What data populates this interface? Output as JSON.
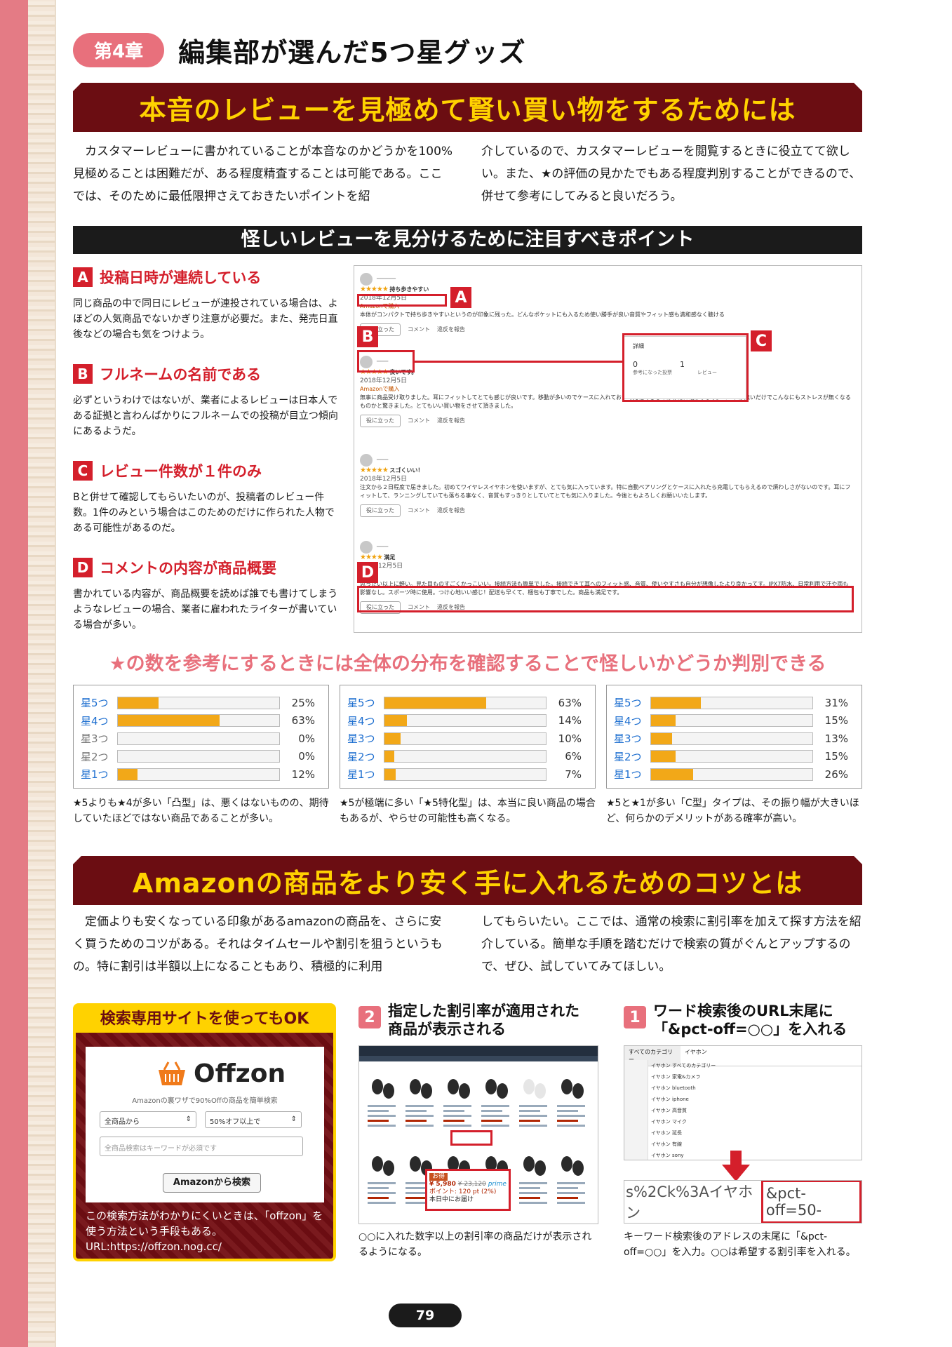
{
  "chapter": {
    "badge": "第4章",
    "title": "編集部が選んだ5つ星グッズ"
  },
  "section1": {
    "banner": "本音のレビューを見極めて賢い買い物をするためには",
    "col1": "カスタマーレビューに書かれていることが本音なのかどうかを100%見極めることは困難だが、ある程度精査することは可能である。ここでは、そのために最低限押さえておきたいポイントを紹",
    "col2": "介しているので、カスタマーレビューを閲覧するときに役立てて欲しい。また、★の評価の見かたでもある程度判別することができるので、併せて参考にしてみると良いだろう。"
  },
  "points_title": "怪しいレビューを見分けるために注目すべきポイント",
  "points": [
    {
      "letter": "A",
      "title": "投稿日時が連続している",
      "desc": "同じ商品の中で同日にレビューが連投されている場合は、よほどの人気商品でないかぎり注意が必要だ。また、発売日直後などの場合も気をつけよう。"
    },
    {
      "letter": "B",
      "title": "フルネームの名前である",
      "desc": "必ずというわけではないが、業者によるレビューは日本人である証拠と言わんばかりにフルネームでの投稿が目立つ傾向にあるようだ。"
    },
    {
      "letter": "C",
      "title": "レビュー件数が１件のみ",
      "desc": "Bと併せて確認してもらいたいのが、投稿者のレビュー件数。1件のみという場合はこのためのだけに作られた人物である可能性があるのだ。"
    },
    {
      "letter": "D",
      "title": "コメントの内容が商品概要",
      "desc": "書かれている内容が、商品概要を読めば誰でも書けてしまうようなレビューの場合、業者に雇われたライターが書いている場合が多い。"
    }
  ],
  "review_shot": {
    "reviews": [
      {
        "headline": "持ち歩きやすい",
        "date": "2018年12月5日",
        "vp": "Amazonで購入",
        "body": "本体がコンパクトで持ち歩きやすいというのが印象に残った。どんなポケットにも入るため使い勝手が良い音質やフィット感も満和感なく聴ける"
      },
      {
        "headline": "良いです。",
        "date": "2018年12月5日",
        "vp": "Amazonで購入",
        "body": "無事に商品受け取りました。耳にフィットしてとても感じが良いです。移動が多いのでケースに入れておいて充電できるのは非常に助かります。コードが無いだけでこんなにもストレスが無くなるものかと驚きました。とてもいい買い物をさせて頂きました。"
      },
      {
        "headline": "スゴくいい！",
        "date": "2018年12月5日",
        "vp": "",
        "body": "注文から２日程度で届きました。初めてワイヤレスイヤホンを使いますが、とても気に入っています。特に自動ペアリングとケースに入れたら充電してもらえるので煩わしさがないのです。耳にフィットして、ランニングしていても落ちる事なく、音質もすっきりとしていてとても気に入りました。今後ともよろしくお願いいたします。"
      },
      {
        "headline": "満足",
        "date": "12月5日",
        "vp": "",
        "body": "思ったい以上に軽い。見た目ものすごくかっこいい。接続方法も簡単でした。接続できて耳へのフィット感、音質、使いやすさも自分が想像したより良かってす。IPX7防水、日常利用で汗や雨も影響なし。スポーツ時に使用。つけ心地いい感じ！配送も早くて、梱包も丁寧でした。商品も満足です。"
      }
    ],
    "helpful_btn": "役に立った",
    "comment_btn": "コメント",
    "report_btn": "違反を報告",
    "stats_title": "詳細",
    "stats_votes": "0",
    "stats_votes_label": "参考になった投票",
    "stats_reviews": "1",
    "stats_reviews_label": "レビュー"
  },
  "dist_title": "★の数を参考にするときには全体の分布を確認することで怪しいかどうか判別できる",
  "distributions": [
    {
      "rows": [
        {
          "label": "星5つ",
          "pct": 25,
          "text": "25%"
        },
        {
          "label": "星4つ",
          "pct": 63,
          "text": "63%"
        },
        {
          "label": "星3つ",
          "pct": 0,
          "text": "0%"
        },
        {
          "label": "星2つ",
          "pct": 0,
          "text": "0%"
        },
        {
          "label": "星1つ",
          "pct": 12,
          "text": "12%"
        }
      ],
      "caption": "★5よりも★4が多い「凸型」は、悪くはないものの、期待していたほどではない商品であることが多い。"
    },
    {
      "rows": [
        {
          "label": "星5つ",
          "pct": 63,
          "text": "63%"
        },
        {
          "label": "星4つ",
          "pct": 14,
          "text": "14%"
        },
        {
          "label": "星3つ",
          "pct": 10,
          "text": "10%"
        },
        {
          "label": "星2つ",
          "pct": 6,
          "text": "6%"
        },
        {
          "label": "星1つ",
          "pct": 7,
          "text": "7%"
        }
      ],
      "caption": "★5が極端に多い「★5特化型」は、本当に良い商品の場合もあるが、やらせの可能性も高くなる。"
    },
    {
      "rows": [
        {
          "label": "星5つ",
          "pct": 31,
          "text": "31%"
        },
        {
          "label": "星4つ",
          "pct": 15,
          "text": "15%"
        },
        {
          "label": "星3つ",
          "pct": 13,
          "text": "13%"
        },
        {
          "label": "星2つ",
          "pct": 15,
          "text": "15%"
        },
        {
          "label": "星1つ",
          "pct": 26,
          "text": "26%"
        }
      ],
      "caption": "★5と★1が多い「C型」タイプは、その振り幅が大きいほど、何らかのデメリットがある確率が高い。"
    }
  ],
  "section2": {
    "banner": "Amazonの商品をより安く手に入れるためのコツとは",
    "col1": "定価よりも安くなっている印象があるamazonの商品を、さらに安く買うためのコツがある。それはタイムセールや割引を狙うというもの。特に割引は半額以上になることもあり、積極的に利用",
    "col2": "してもらいたい。ここでは、通常の検索に割引率を加えて探す方法を紹介している。簡単な手順を踏むだけで検索の質がぐんとアップするので、ぜひ、試していてみてほしい。"
  },
  "offzon": {
    "header": "検索専用サイトを使ってもOK",
    "logo": "Offzon",
    "tagline": "Amazonの裏ワザで90%Offの商品を簡単検索",
    "select1": "全商品から",
    "select2": "50%オフ以上で",
    "input_placeholder": "全商品検索はキーワードが必須です",
    "button": "Amazonから検索",
    "note": "この検索方法がわかりにくいときは、「offzon」を使う方法という手段もある。URL:https://offzon.nog.cc/"
  },
  "step2": {
    "num": "2",
    "title": "指定した割引率が適用された商品が表示される",
    "badge": "お得",
    "price": "¥ 5,980",
    "old_price": "¥ 23,120",
    "prime": "prime",
    "points": "ポイント: 120 pt (2%)",
    "delivery": "本日中にお届け",
    "caption": "○○に入れた数字以上の割引率の商品だけが表示されるようになる。"
  },
  "step1": {
    "num": "1",
    "title": "ワード検索後のURL末尾に「&pct-off=○○」を入れる",
    "dropdown_head": "すべてのカテゴリー",
    "query": "イヤホン",
    "suggestions": [
      "イヤホン すべてのカテゴリー",
      "イヤホン 家電&カメラ",
      "イヤホン bluetooth",
      "イヤホン iphone",
      "イヤホン 高音質",
      "イヤホン マイク",
      "イヤホン 延長",
      "イヤホン 有線",
      "イヤホン sony"
    ],
    "url_prefix": "s%2Ck%3Aイヤホン",
    "url_param": "&pct-off=50-",
    "caption": "キーワード検索後のアドレスの末尾に「&pct-off=○○」を入力。○○は希望する割引率を入れる。"
  },
  "page_number": "79"
}
